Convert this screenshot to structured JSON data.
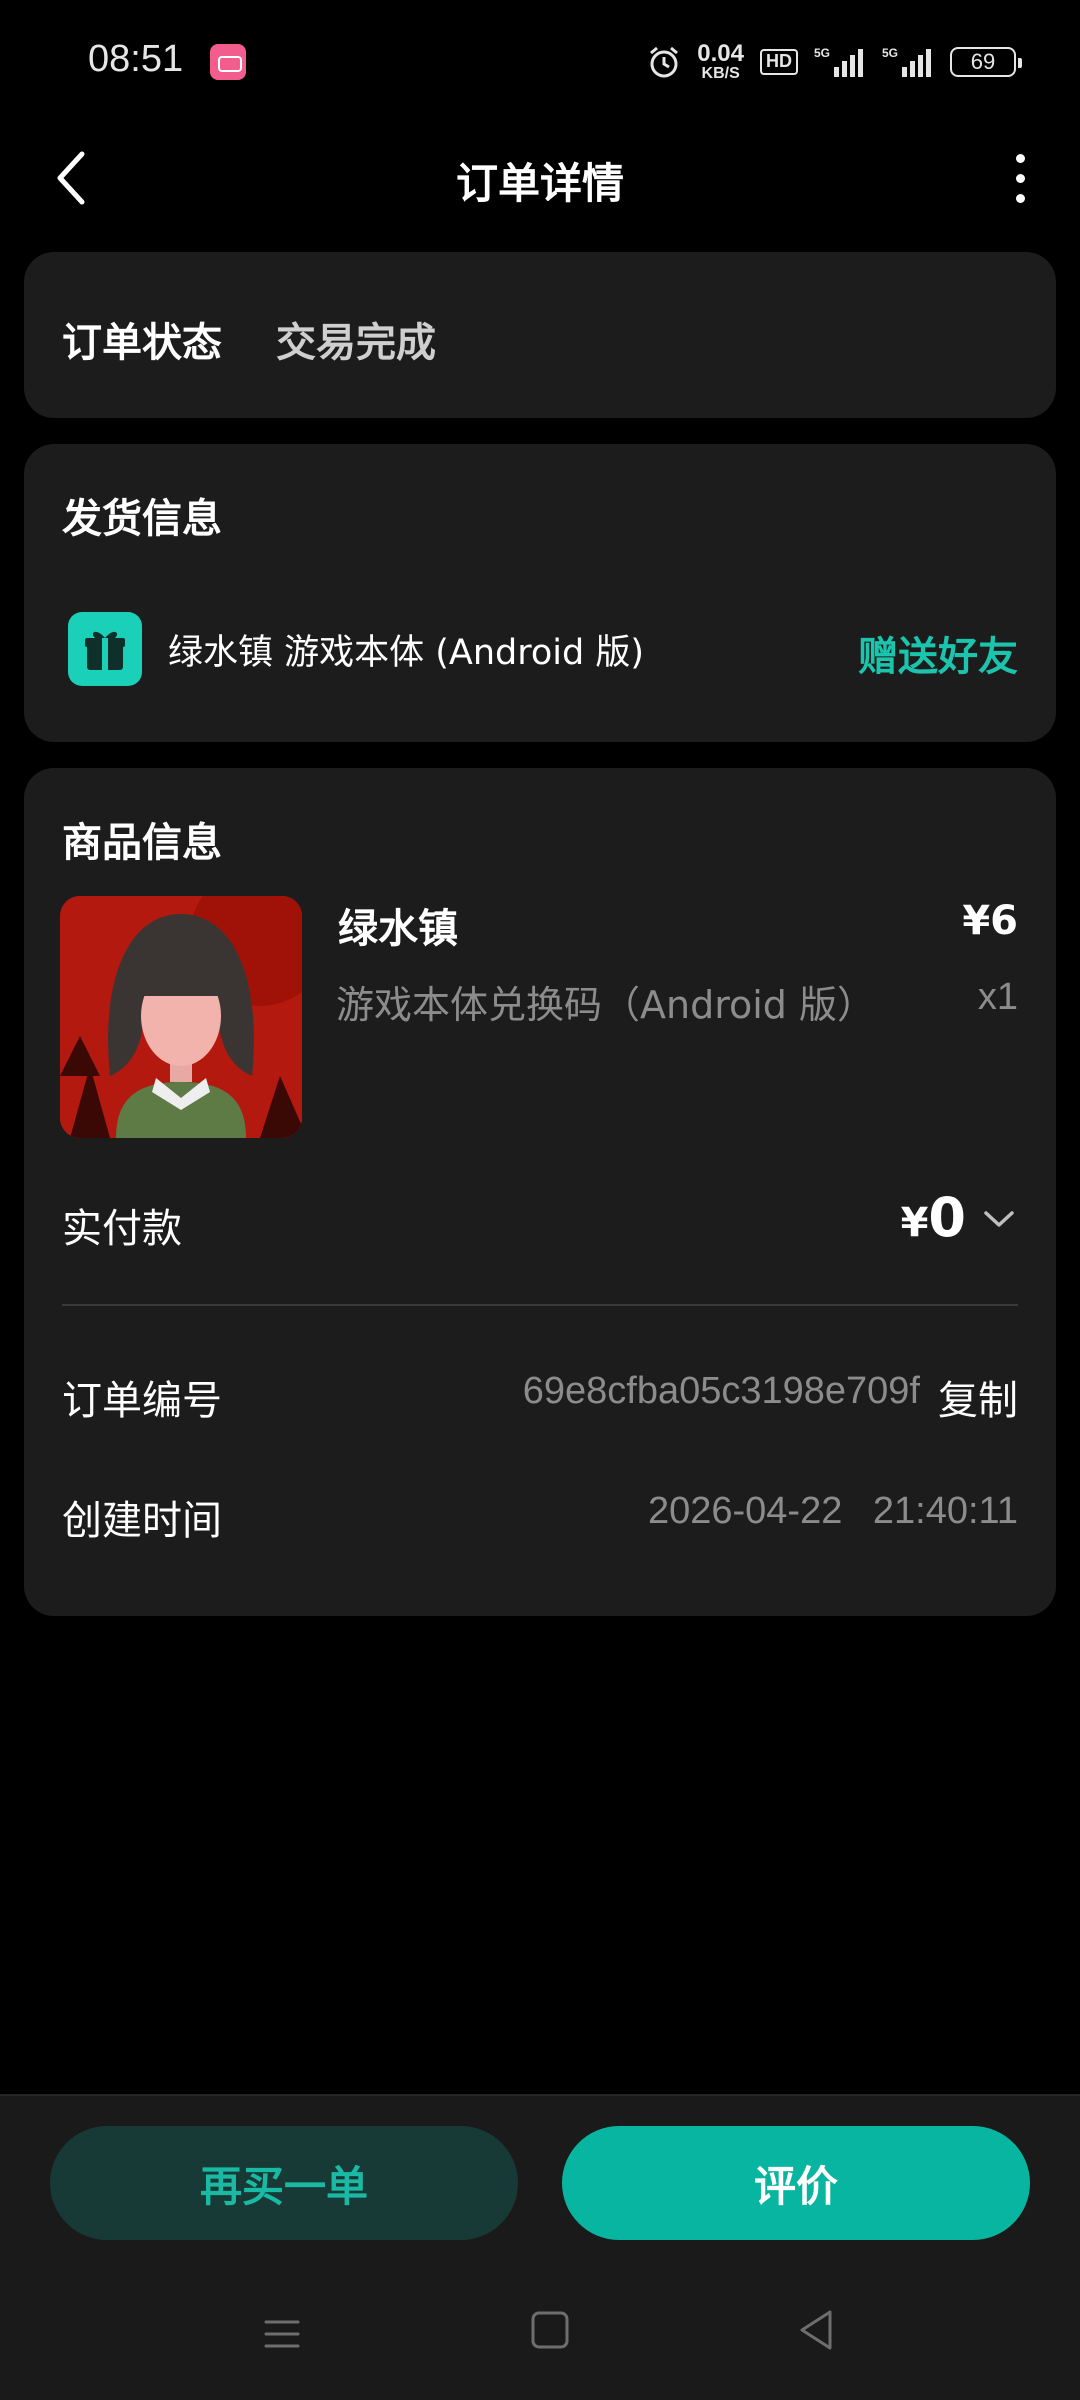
{
  "status_bar": {
    "time": "08:51",
    "net_speed_value": "0.04",
    "net_speed_unit": "KB/S",
    "hd_label": "HD",
    "signal1_label": "5G",
    "signal2_label": "5G",
    "battery": "69"
  },
  "header": {
    "title": "订单详情"
  },
  "order_status": {
    "label": "订单状态",
    "value": "交易完成"
  },
  "shipping": {
    "title": "发货信息",
    "item": "绿水镇 游戏本体 (Android 版)",
    "gift_button": "赠送好友"
  },
  "goods": {
    "title": "商品信息",
    "name": "绿水镇",
    "price": "¥6",
    "description": "游戏本体兑换码（Android 版）",
    "quantity": "x1",
    "paid_label": "实付款",
    "paid_currency": "¥",
    "paid_amount": "0",
    "order_no_label": "订单编号",
    "order_no": "69e8cfba05c3198e709f",
    "copy_button": "复制",
    "created_label": "创建时间",
    "created_time": "2026-04-22 21:40:11"
  },
  "actions": {
    "rebuy": "再买一单",
    "review": "评价"
  },
  "colors": {
    "accent": "#1ac4ad",
    "card_bg": "#1c1c1c",
    "page_bg": "#000000"
  }
}
